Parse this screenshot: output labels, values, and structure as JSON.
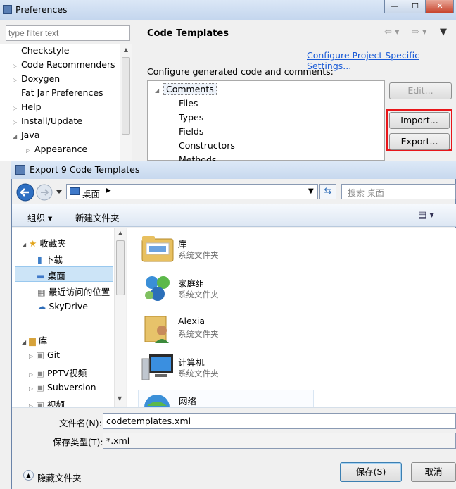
{
  "pref": {
    "title": "Preferences",
    "min": "—",
    "max": "☐",
    "close": "✕",
    "filter_placeholder": "type filter text",
    "tree": [
      {
        "label": "Checkstyle",
        "tri": ""
      },
      {
        "label": "Code Recommenders",
        "tri": "▷"
      },
      {
        "label": "Doxygen",
        "tri": "▷"
      },
      {
        "label": "Fat Jar Preferences",
        "tri": ""
      },
      {
        "label": "Help",
        "tri": "▷"
      },
      {
        "label": "Install/Update",
        "tri": "▷"
      },
      {
        "label": "Java",
        "tri": "◢"
      },
      {
        "label": "Appearance",
        "tri": "▷"
      }
    ],
    "section_title": "Code Templates",
    "project_link": "Configure Project Specific Settings...",
    "configure_label": "Configure generated code and comments:",
    "templates": {
      "root": "Comments",
      "children": [
        "Files",
        "Types",
        "Fields",
        "Constructors",
        "Methods"
      ]
    },
    "buttons": {
      "edit": "Edit...",
      "import": "Import...",
      "export": "Export..."
    }
  },
  "dialog": {
    "title": "Export 9 Code Templates",
    "address": "桌面",
    "search_placeholder": "搜索 桌面",
    "organize": "组织 ▾",
    "new_folder": "新建文件夹",
    "nav": {
      "favorites": "收藏夹",
      "fav_items": [
        "下载",
        "桌面",
        "最近访问的位置",
        "SkyDrive"
      ],
      "library": "库",
      "lib_items": [
        "Git",
        "PPTV视频",
        "Subversion",
        "视频"
      ]
    },
    "files": [
      {
        "name": "库",
        "type": "系统文件夹"
      },
      {
        "name": "家庭组",
        "type": "系统文件夹"
      },
      {
        "name": "Alexia",
        "type": "系统文件夹"
      },
      {
        "name": "计算机",
        "type": "系统文件夹"
      },
      {
        "name": "网络",
        "type": ""
      }
    ],
    "filename_label": "文件名(N):",
    "filename_value": "codetemplates.xml",
    "filetype_label": "保存类型(T):",
    "filetype_value": "*.xml",
    "hide_folders": "隐藏文件夹",
    "save": "保存(S)",
    "cancel": "取消"
  },
  "colors": {
    "highlight": "#e8161a",
    "link": "#1a5bd7"
  }
}
